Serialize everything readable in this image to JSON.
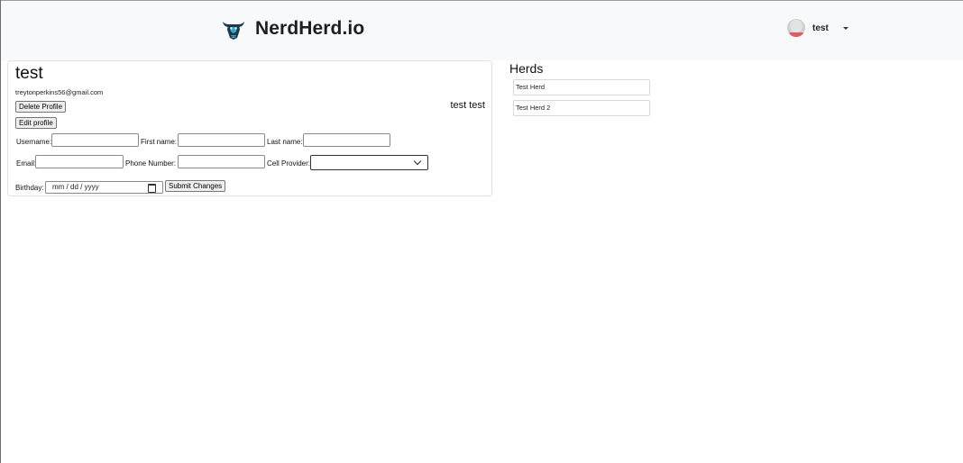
{
  "navbar": {
    "brand_name": "NerdHerd.io",
    "brand_icon": "bull-logo-icon",
    "user": {
      "name": "test",
      "avatar_icon": "user-avatar-icon",
      "menu_icon": "caret-down-icon"
    }
  },
  "profile": {
    "title": "test",
    "email": "treytonperkins56@gmail.com",
    "full_name": "test test",
    "delete_label": "Delete Profile",
    "edit_label": "Edit profile",
    "form": {
      "username_label": "Username:",
      "first_name_label": "First name:",
      "last_name_label": "Last name:",
      "email_label": "Email:",
      "phone_label": "Phone Number:",
      "cell_provider_label": "Cell Provider:",
      "birthday_label": "Birthday:",
      "birthday_placeholder": "mm / dd / yyyy",
      "submit_label": "Submit Changes"
    }
  },
  "herds": {
    "title": "Herds",
    "items": [
      {
        "label": "Test Herd"
      },
      {
        "label": "Test Herd 2"
      }
    ]
  },
  "colors": {
    "navbar_bg": "#f8f9fa",
    "logo_accent": "#3aa6c4",
    "logo_dark": "#1e3a4a"
  }
}
